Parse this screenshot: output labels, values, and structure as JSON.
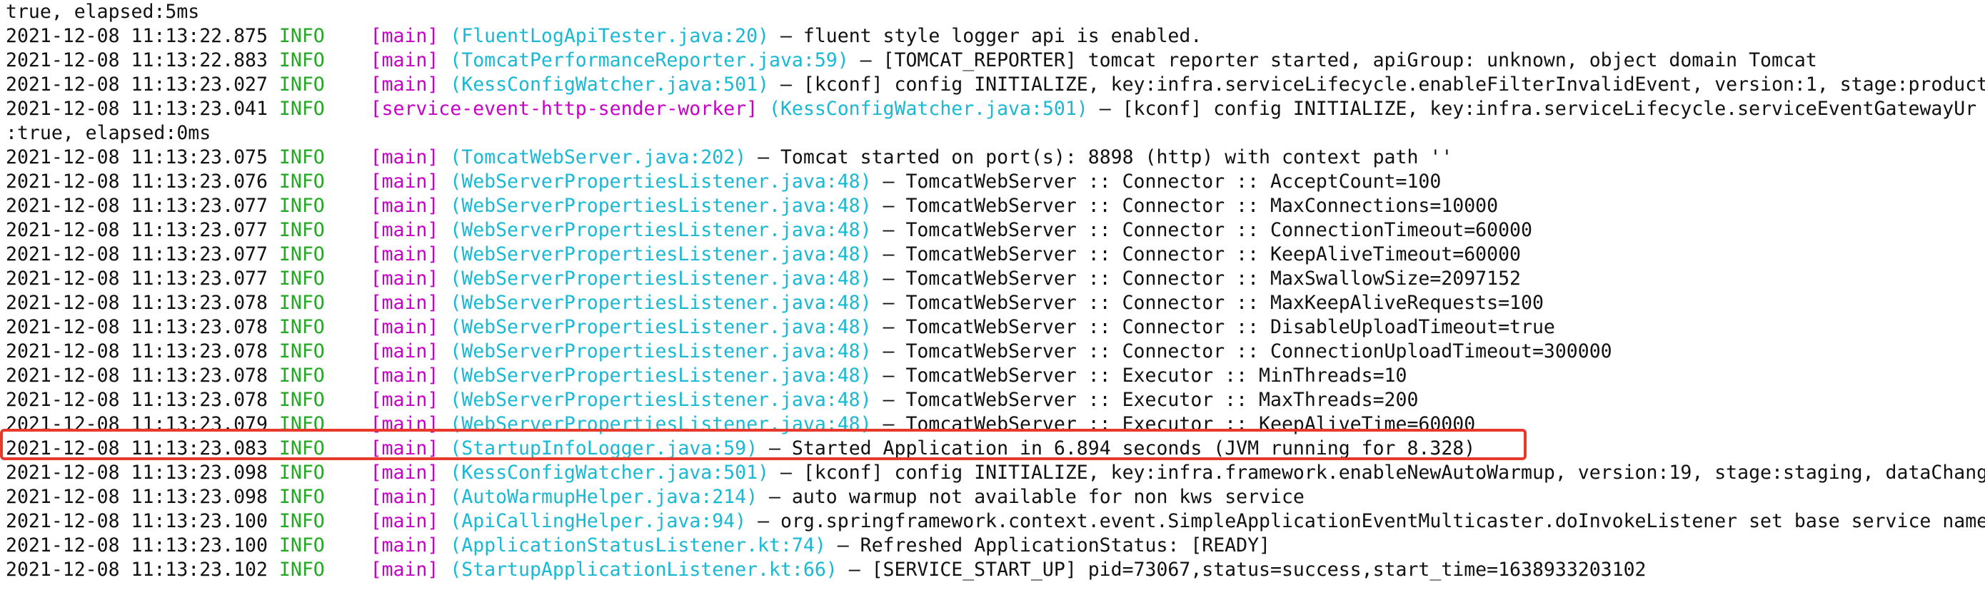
{
  "console": {
    "lines": [
      {
        "ts": "true, elapsed:5ms",
        "level": "",
        "thread": "",
        "source": "",
        "msg": ""
      },
      {
        "ts": "2021-12-08 11:13:22.875",
        "level": "INFO",
        "thread": "[main]",
        "source": "(FluentLogApiTester.java:20)",
        "msg": " – fluent style logger api is enabled."
      },
      {
        "ts": "2021-12-08 11:13:22.883",
        "level": "INFO",
        "thread": "[main]",
        "source": "(TomcatPerformanceReporter.java:59)",
        "msg": " – [TOMCAT_REPORTER] tomcat reporter started, apiGroup: unknown, object domain Tomcat"
      },
      {
        "ts": "2021-12-08 11:13:23.027",
        "level": "INFO",
        "thread": "[main]",
        "source": "(KessConfigWatcher.java:501)",
        "msg": " – [kconf] config INITIALIZE, key:infra.serviceLifecycle.enableFilterInvalidEvent, version:1, stage:product"
      },
      {
        "ts": "2021-12-08 11:13:23.041",
        "level": "INFO",
        "thread": "[service-event-http-sender-worker]",
        "source": "(KessConfigWatcher.java:501)",
        "msg": " – [kconf] config INITIALIZE, key:infra.serviceLifecycle.serviceEventGatewayUr"
      },
      {
        "ts": ":true, elapsed:0ms",
        "level": "",
        "thread": "",
        "source": "",
        "msg": ""
      },
      {
        "ts": "2021-12-08 11:13:23.075",
        "level": "INFO",
        "thread": "[main]",
        "source": "(TomcatWebServer.java:202)",
        "msg": " – Tomcat started on port(s): 8898 (http) with context path ''"
      },
      {
        "ts": "2021-12-08 11:13:23.076",
        "level": "INFO",
        "thread": "[main]",
        "source": "(WebServerPropertiesListener.java:48)",
        "msg": " – TomcatWebServer :: Connector :: AcceptCount=100"
      },
      {
        "ts": "2021-12-08 11:13:23.077",
        "level": "INFO",
        "thread": "[main]",
        "source": "(WebServerPropertiesListener.java:48)",
        "msg": " – TomcatWebServer :: Connector :: MaxConnections=10000"
      },
      {
        "ts": "2021-12-08 11:13:23.077",
        "level": "INFO",
        "thread": "[main]",
        "source": "(WebServerPropertiesListener.java:48)",
        "msg": " – TomcatWebServer :: Connector :: ConnectionTimeout=60000"
      },
      {
        "ts": "2021-12-08 11:13:23.077",
        "level": "INFO",
        "thread": "[main]",
        "source": "(WebServerPropertiesListener.java:48)",
        "msg": " – TomcatWebServer :: Connector :: KeepAliveTimeout=60000"
      },
      {
        "ts": "2021-12-08 11:13:23.077",
        "level": "INFO",
        "thread": "[main]",
        "source": "(WebServerPropertiesListener.java:48)",
        "msg": " – TomcatWebServer :: Connector :: MaxSwallowSize=2097152"
      },
      {
        "ts": "2021-12-08 11:13:23.078",
        "level": "INFO",
        "thread": "[main]",
        "source": "(WebServerPropertiesListener.java:48)",
        "msg": " – TomcatWebServer :: Connector :: MaxKeepAliveRequests=100"
      },
      {
        "ts": "2021-12-08 11:13:23.078",
        "level": "INFO",
        "thread": "[main]",
        "source": "(WebServerPropertiesListener.java:48)",
        "msg": " – TomcatWebServer :: Connector :: DisableUploadTimeout=true"
      },
      {
        "ts": "2021-12-08 11:13:23.078",
        "level": "INFO",
        "thread": "[main]",
        "source": "(WebServerPropertiesListener.java:48)",
        "msg": " – TomcatWebServer :: Connector :: ConnectionUploadTimeout=300000"
      },
      {
        "ts": "2021-12-08 11:13:23.078",
        "level": "INFO",
        "thread": "[main]",
        "source": "(WebServerPropertiesListener.java:48)",
        "msg": " – TomcatWebServer :: Executor :: MinThreads=10"
      },
      {
        "ts": "2021-12-08 11:13:23.078",
        "level": "INFO",
        "thread": "[main]",
        "source": "(WebServerPropertiesListener.java:48)",
        "msg": " – TomcatWebServer :: Executor :: MaxThreads=200"
      },
      {
        "ts": "2021-12-08 11:13:23.079",
        "level": "INFO",
        "thread": "[main]",
        "source": "(WebServerPropertiesListener.java:48)",
        "msg": " – TomcatWebServer :: Executor :: KeepAliveTime=60000"
      },
      {
        "ts": "2021-12-08 11:13:23.083",
        "level": "INFO",
        "thread": "[main]",
        "source": "(StartupInfoLogger.java:59)",
        "msg": " – Started Application in 6.894 seconds (JVM running for 8.328)"
      },
      {
        "ts": "2021-12-08 11:13:23.098",
        "level": "INFO",
        "thread": "[main]",
        "source": "(KessConfigWatcher.java:501)",
        "msg": " – [kconf] config INITIALIZE, key:infra.framework.enableNewAutoWarmup, version:19, stage:staging, dataChang"
      },
      {
        "ts": "2021-12-08 11:13:23.098",
        "level": "INFO",
        "thread": "[main]",
        "source": "(AutoWarmupHelper.java:214)",
        "msg": " – auto warmup not available for non kws service"
      },
      {
        "ts": "2021-12-08 11:13:23.100",
        "level": "INFO",
        "thread": "[main]",
        "source": "(ApiCallingHelper.java:94)",
        "msg": " – org.springframework.context.event.SimpleApplicationEventMulticaster.doInvokeListener set base service name"
      },
      {
        "ts": "2021-12-08 11:13:23.100",
        "level": "INFO",
        "thread": "[main]",
        "source": "(ApplicationStatusListener.kt:74)",
        "msg": " – Refreshed ApplicationStatus: [READY]"
      },
      {
        "ts": "2021-12-08 11:13:23.102",
        "level": "INFO",
        "thread": "[main]",
        "source": "(StartupApplicationListener.kt:66)",
        "msg": " – [SERVICE_START_UP] pid=73067,status=success,start_time=1638933203102"
      }
    ]
  },
  "colors": {
    "background": "#ffffff",
    "text": "#111111",
    "level_info": "#22a822",
    "thread": "#c800c8",
    "source": "#19b8d4",
    "highlight_border": "#e83a2c"
  },
  "highlight": {
    "line_index": 18
  }
}
